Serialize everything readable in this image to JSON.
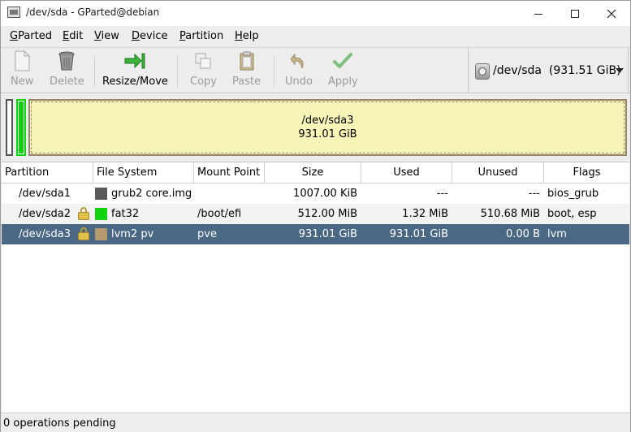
{
  "window": {
    "title": "/dev/sda - GParted@debian"
  },
  "menu": [
    {
      "prefix": "",
      "accel": "G",
      "rest": "Parted"
    },
    {
      "prefix": "",
      "accel": "E",
      "rest": "dit"
    },
    {
      "prefix": "",
      "accel": "V",
      "rest": "iew"
    },
    {
      "prefix": "",
      "accel": "D",
      "rest": "evice"
    },
    {
      "prefix": "",
      "accel": "P",
      "rest": "artition"
    },
    {
      "prefix": "",
      "accel": "H",
      "rest": "elp"
    }
  ],
  "toolbar": {
    "new": "New",
    "delete": "Delete",
    "resize": "Resize/Move",
    "copy": "Copy",
    "paste": "Paste",
    "undo": "Undo",
    "apply": "Apply"
  },
  "device_selector": {
    "device": "/dev/sda",
    "size": "(931.51 GiB)"
  },
  "disk_graphic": {
    "name": "/dev/sda3",
    "size": "931.01 GiB"
  },
  "table": {
    "headers": [
      "Partition",
      "File System",
      "Mount Point",
      "Size",
      "Used",
      "Unused",
      "Flags"
    ],
    "rows": [
      {
        "partition": "/dev/sda1",
        "locked": false,
        "fs_color": "#5a5a5a",
        "filesystem": "grub2 core.img",
        "mount": "",
        "size": "1007.00 KiB",
        "used": "---",
        "unused": "---",
        "flags": "bios_grub"
      },
      {
        "partition": "/dev/sda2",
        "locked": true,
        "fs_color": "#11d411",
        "filesystem": "fat32",
        "mount": "/boot/efi",
        "size": "512.00 MiB",
        "used": "1.32 MiB",
        "unused": "510.68 MiB",
        "flags": "boot, esp"
      },
      {
        "partition": "/dev/sda3",
        "locked": true,
        "fs_color": "#b69a6f",
        "filesystem": "lvm2 pv",
        "mount": "pve",
        "size": "931.01 GiB",
        "used": "931.01 GiB",
        "unused": "0.00 B",
        "flags": "lvm"
      }
    ]
  },
  "status": {
    "text": "0 operations pending"
  }
}
